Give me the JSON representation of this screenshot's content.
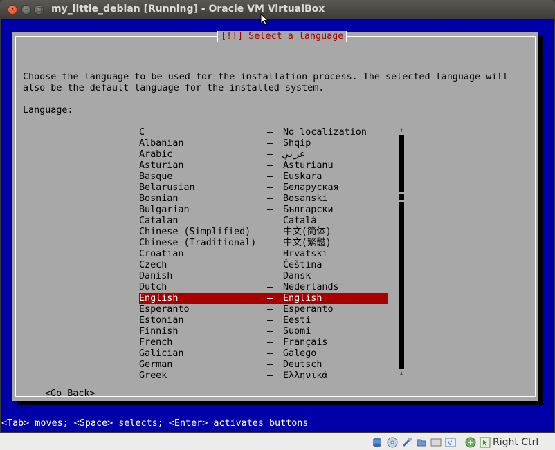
{
  "window": {
    "title": "my_little_debian [Running] - Oracle VM VirtualBox",
    "close_glyph": "×",
    "min_glyph": "–",
    "max_glyph": "□"
  },
  "dialog": {
    "title": "[!!] Select a language",
    "intro_line1": "Choose the language to be used for the installation process. The selected language will",
    "intro_line2": "also be the default language for the installed system.",
    "list_label": "Language:",
    "separator": "–",
    "languages": [
      {
        "name": "C",
        "native": "No localization"
      },
      {
        "name": "Albanian",
        "native": "Shqip"
      },
      {
        "name": "Arabic",
        "native": "عربي"
      },
      {
        "name": "Asturian",
        "native": "Asturianu"
      },
      {
        "name": "Basque",
        "native": "Euskara"
      },
      {
        "name": "Belarusian",
        "native": "Беларуская"
      },
      {
        "name": "Bosnian",
        "native": "Bosanski"
      },
      {
        "name": "Bulgarian",
        "native": "Български"
      },
      {
        "name": "Catalan",
        "native": "Català"
      },
      {
        "name": "Chinese (Simplified)",
        "native": "中文(简体)"
      },
      {
        "name": "Chinese (Traditional)",
        "native": "中文(繁體)"
      },
      {
        "name": "Croatian",
        "native": "Hrvatski"
      },
      {
        "name": "Czech",
        "native": "Čeština"
      },
      {
        "name": "Danish",
        "native": "Dansk"
      },
      {
        "name": "Dutch",
        "native": "Nederlands"
      },
      {
        "name": "English",
        "native": "English",
        "selected": true
      },
      {
        "name": "Esperanto",
        "native": "Esperanto"
      },
      {
        "name": "Estonian",
        "native": "Eesti"
      },
      {
        "name": "Finnish",
        "native": "Suomi"
      },
      {
        "name": "French",
        "native": "Français"
      },
      {
        "name": "Galician",
        "native": "Galego"
      },
      {
        "name": "German",
        "native": "Deutsch"
      },
      {
        "name": "Greek",
        "native": "Ελληνικά"
      }
    ],
    "scroll_up_glyph": "↑",
    "scroll_down_glyph": "↓",
    "go_back_label": "<Go Back>"
  },
  "hint_bar": "<Tab> moves; <Space> selects; <Enter> activates buttons",
  "statusbar": {
    "icons": [
      "hard-disk-icon",
      "optical-drive-icon",
      "usb-icon",
      "shared-folders-icon",
      "display-icon",
      "video-capture-icon",
      "network-icon",
      "mouse-integration-icon"
    ],
    "host_key": "Right Ctrl"
  },
  "colors": {
    "screen_bg": "#0000a8",
    "dialog_bg": "#a8a8a8",
    "title_fg": "#a80000",
    "selected_bg": "#a80000"
  }
}
